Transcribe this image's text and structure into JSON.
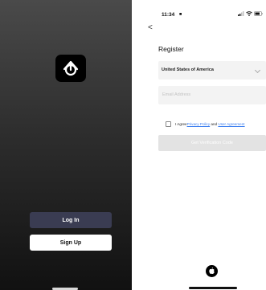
{
  "welcome": {
    "login_label": "Log In",
    "signup_label": "Sign Up"
  },
  "register": {
    "status_time": "11:34",
    "status_glyph": "■",
    "back_glyph": "<",
    "title": "Register",
    "country": "United States of America",
    "email_placeholder": "Email Address",
    "agree_prefix": "I Agree",
    "privacy_link": "Privacy Policy",
    "agree_and": " and ",
    "user_agreement_link": "User Agreement",
    "verify_button": "Get Verification Code"
  },
  "colors": {
    "login_button": "#3a3c52",
    "link": "#3d7ff0",
    "disabled_button": "#e3e3e3"
  },
  "icons": [
    "power-logo-icon",
    "signal-icon",
    "wifi-icon",
    "battery-icon",
    "chevron-down-icon",
    "apple-icon"
  ]
}
